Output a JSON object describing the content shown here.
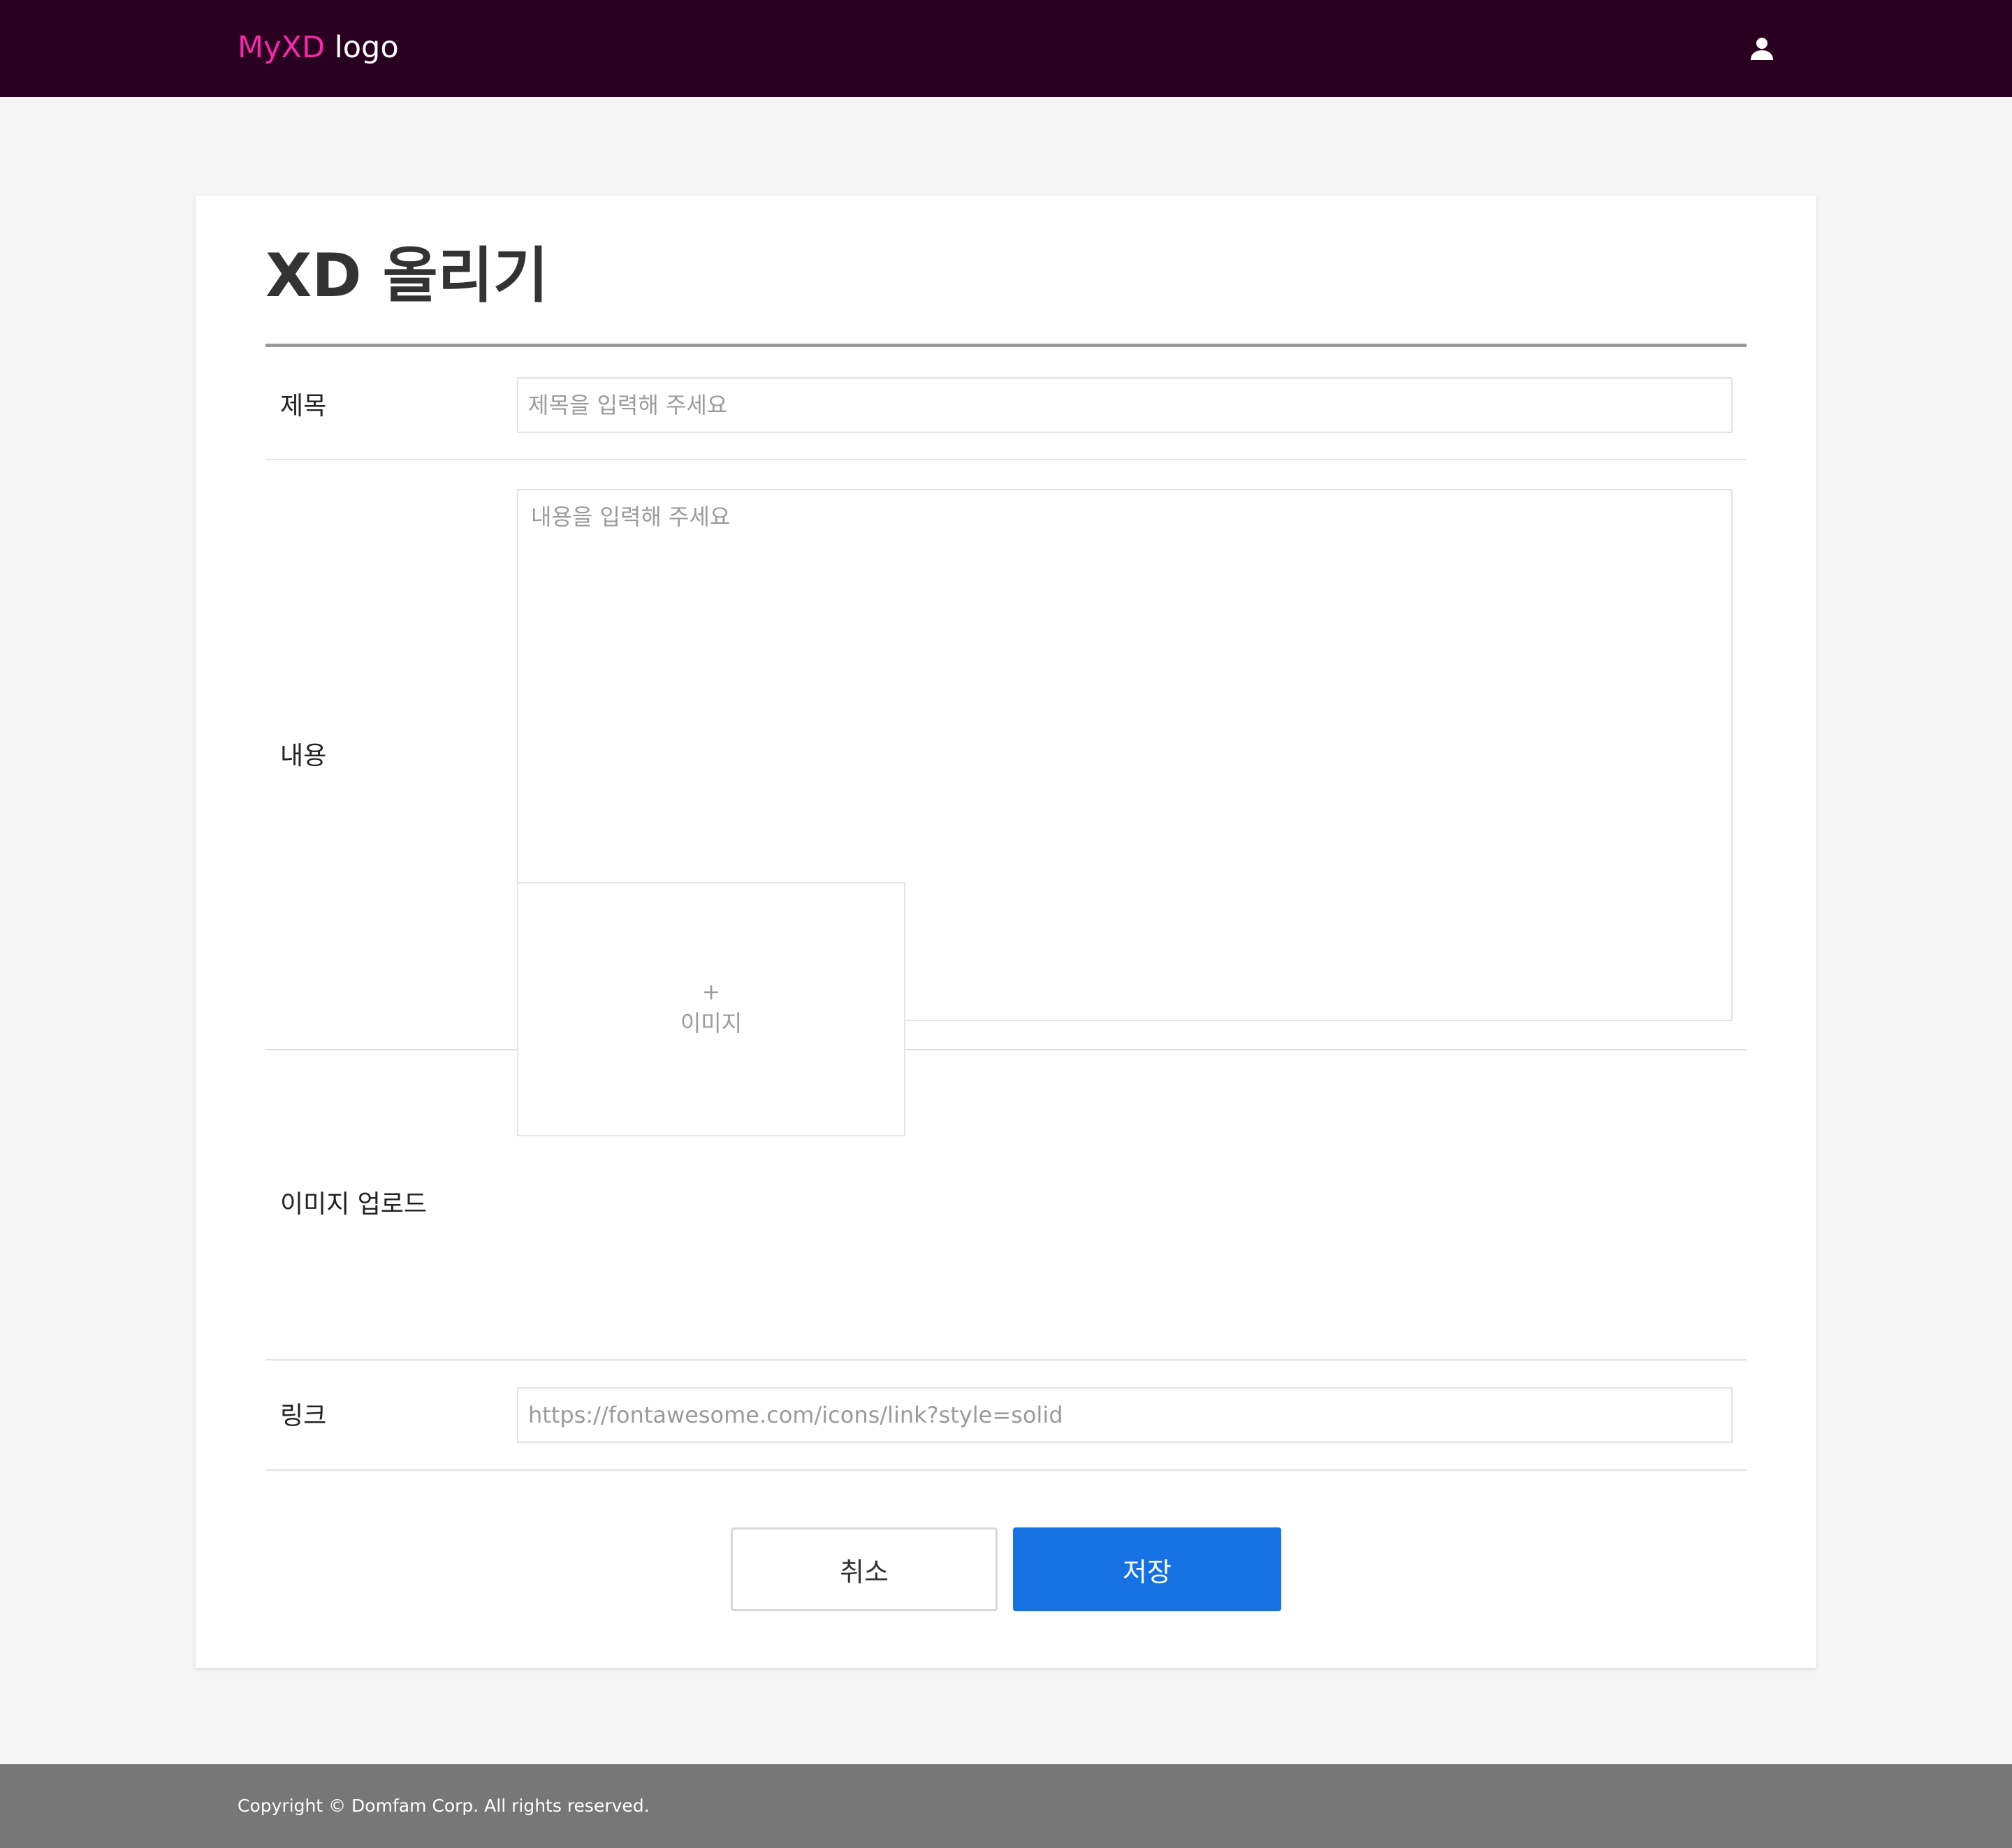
{
  "header": {
    "logo_brand": "MyXD",
    "logo_suffix": " logo",
    "user_icon": "user-icon"
  },
  "form": {
    "title": "XD 올리기",
    "fields": {
      "title": {
        "label": "제목",
        "placeholder": "제목을 입력해 주세요"
      },
      "content": {
        "label": "내용",
        "placeholder": "내용을 입력해 주세요"
      },
      "image": {
        "label": "이미지 업로드",
        "plus": "+",
        "upload_text": "이미지"
      },
      "link": {
        "label": "링크",
        "placeholder": "https://fontawesome.com/icons/link?style=solid"
      }
    },
    "buttons": {
      "cancel": "취소",
      "save": "저장"
    }
  },
  "footer": {
    "copyright": "Copyright © Domfam Corp. All rights reserved."
  },
  "colors": {
    "header_bg": "#2a0020",
    "logo_accent": "#f22aa9",
    "primary": "#1572e3",
    "footer_bg": "#777777",
    "page_bg": "#f6f6f6"
  }
}
